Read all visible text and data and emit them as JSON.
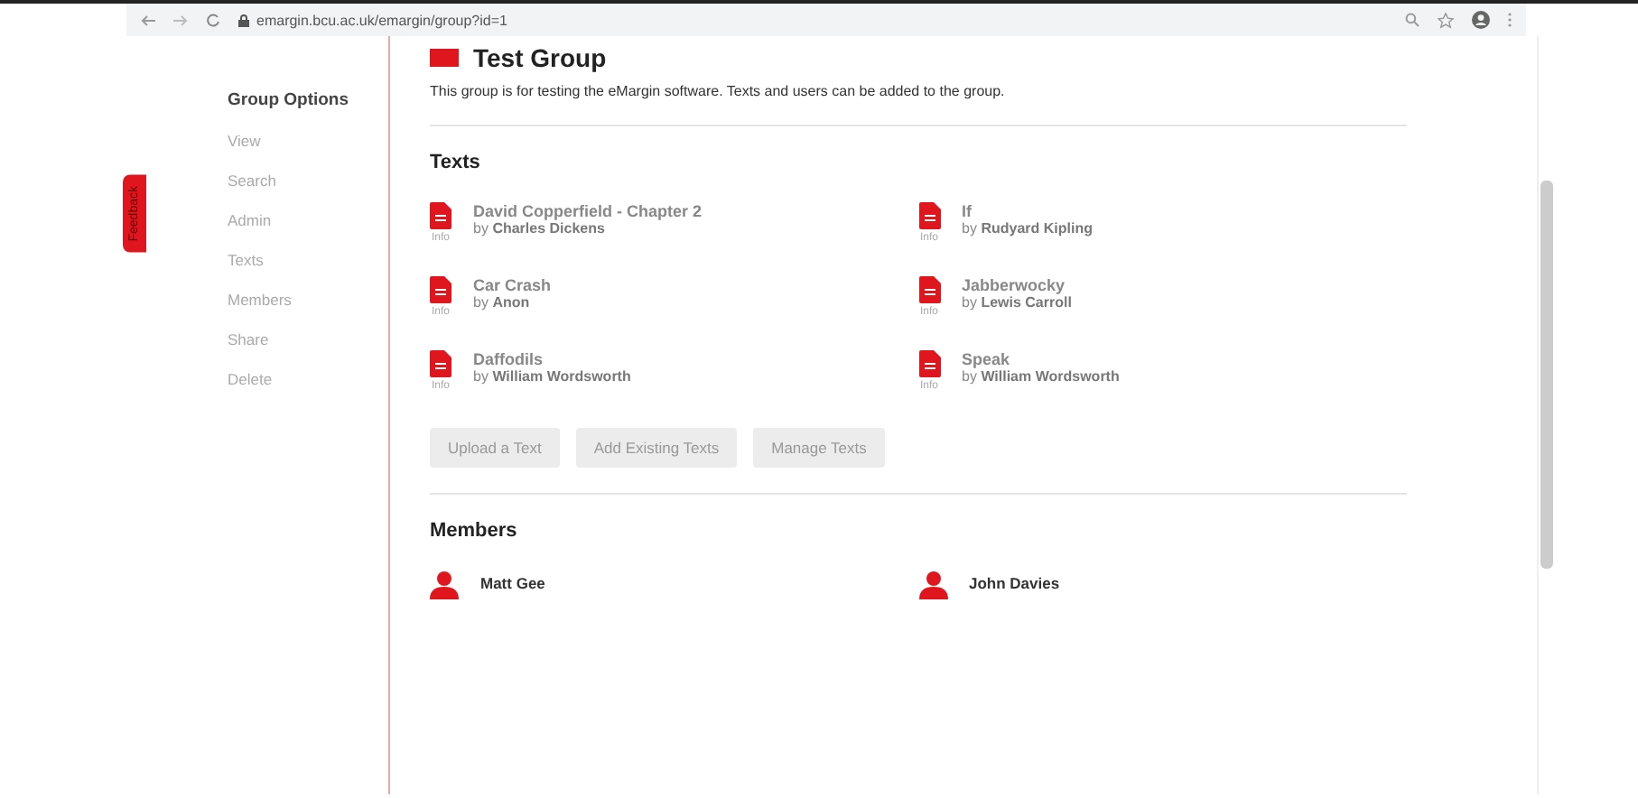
{
  "browser": {
    "url": "emargin.bcu.ac.uk/emargin/group?id=1"
  },
  "feedback": "Feedback",
  "sidebar": {
    "title": "Group Options",
    "items": [
      "View",
      "Search",
      "Admin",
      "Texts",
      "Members",
      "Share",
      "Delete"
    ]
  },
  "group": {
    "title": "Test Group",
    "description": "This group is for testing the eMargin software. Texts and users can be added to the group."
  },
  "texts": {
    "heading": "Texts",
    "items": [
      {
        "title": "David Copperfield - Chapter 2",
        "by": "by",
        "author": "Charles Dickens",
        "info": "Info"
      },
      {
        "title": "If",
        "by": "by",
        "author": "Rudyard Kipling",
        "info": "Info"
      },
      {
        "title": "Car Crash",
        "by": "by",
        "author": "Anon",
        "info": "Info"
      },
      {
        "title": "Jabberwocky",
        "by": "by",
        "author": "Lewis Carroll",
        "info": "Info"
      },
      {
        "title": "Daffodils",
        "by": "by",
        "author": "William Wordsworth",
        "info": "Info"
      },
      {
        "title": "Speak",
        "by": "by",
        "author": "William Wordsworth",
        "info": "Info"
      }
    ],
    "buttons": [
      "Upload a Text",
      "Add Existing Texts",
      "Manage Texts"
    ]
  },
  "members": {
    "heading": "Members",
    "items": [
      "Matt Gee",
      "John Davies"
    ]
  }
}
